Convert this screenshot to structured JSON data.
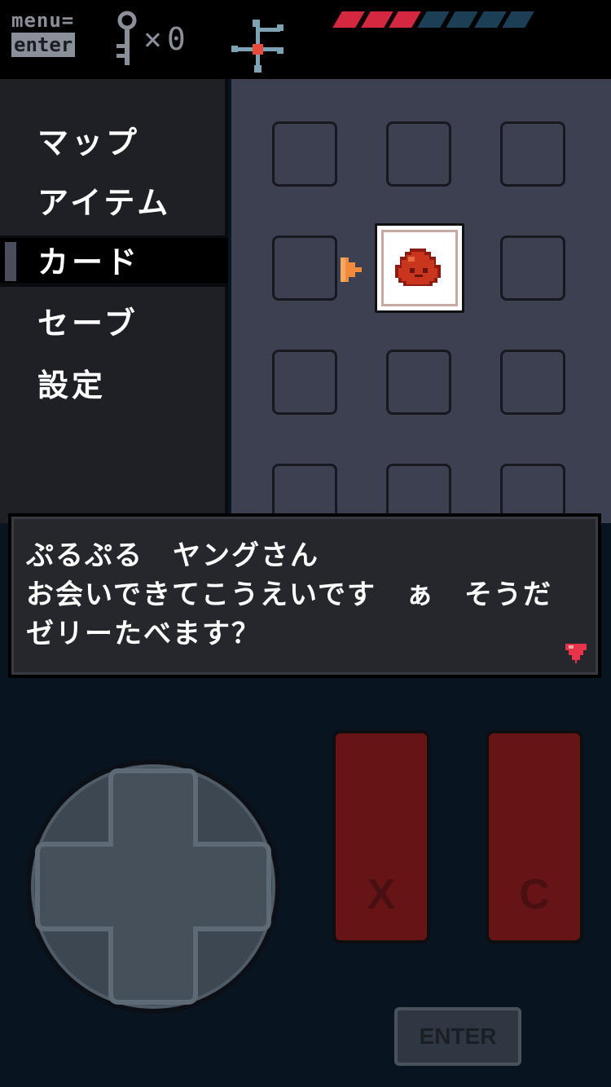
{
  "hud": {
    "menu_hint_line1": "menu=",
    "menu_hint_line2": "enter",
    "key_count": "×0",
    "health": {
      "filled": 3,
      "total": 7
    }
  },
  "menu": {
    "items": [
      {
        "label": "マップ"
      },
      {
        "label": "アイテム"
      },
      {
        "label": "カード"
      },
      {
        "label": "セーブ"
      },
      {
        "label": "設定"
      }
    ],
    "selected_index": 2
  },
  "dialog": {
    "lines": [
      "ぷるぷる　ヤングさん",
      "お会いできてこうえいです　ぁ　そうだ",
      "ゼリーたべます？"
    ]
  },
  "controls": {
    "x_button": "X",
    "c_button": "C",
    "enter_button": "ENTER"
  },
  "colors": {
    "health_full": "#d3283f",
    "health_empty": "#1d3f55",
    "button_red": "#671417",
    "map_bg": "#3c4050"
  }
}
